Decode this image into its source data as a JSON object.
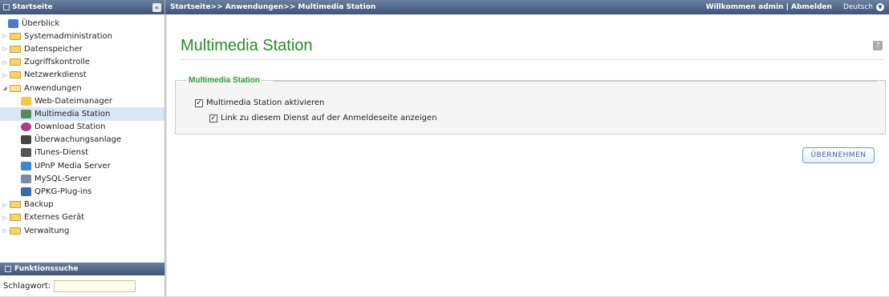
{
  "sidebar": {
    "title": "Startseite",
    "collapse_glyph": "«",
    "items": [
      {
        "label": "Überblick",
        "level": "top",
        "icon": "overview-icon"
      },
      {
        "label": "Systemadministration",
        "level": "folder"
      },
      {
        "label": "Datenspeicher",
        "level": "folder"
      },
      {
        "label": "Zugriffskontrolle",
        "level": "folder"
      },
      {
        "label": "Netzwerkdienst",
        "level": "folder"
      },
      {
        "label": "Anwendungen",
        "level": "folder-open"
      },
      {
        "label": "Web-Dateimanager",
        "level": "child",
        "icon": "folder-icon",
        "color": "#f3c84a"
      },
      {
        "label": "Multimedia Station",
        "level": "child",
        "icon": "multimedia-icon",
        "color": "#5a8a5a",
        "selected": true
      },
      {
        "label": "Download Station",
        "level": "child",
        "icon": "download-icon",
        "color": "#b03a8a"
      },
      {
        "label": "Überwachungsanlage",
        "level": "child",
        "icon": "camera-icon",
        "color": "#444444"
      },
      {
        "label": "iTunes-Dienst",
        "level": "child",
        "icon": "apple-icon",
        "color": "#555555"
      },
      {
        "label": "UPnP Media Server",
        "level": "child",
        "icon": "upnp-icon",
        "color": "#3a8ac7"
      },
      {
        "label": "MySQL-Server",
        "level": "child",
        "icon": "mysql-icon",
        "color": "#7a8aa0"
      },
      {
        "label": "QPKG-Plug-ins",
        "level": "child",
        "icon": "qpkg-icon",
        "color": "#3a6ab0"
      },
      {
        "label": "Backup",
        "level": "folder"
      },
      {
        "label": "Externes Gerät",
        "level": "folder"
      },
      {
        "label": "Verwaltung",
        "level": "folder"
      }
    ]
  },
  "search": {
    "title": "Funktionssuche",
    "label": "Schlagwort:",
    "value": ""
  },
  "topbar": {
    "breadcrumb": "Startseite>> Anwendungen>> Multimedia Station",
    "welcome": "Willkommen admin | Abmelden",
    "language": "Deutsch"
  },
  "main": {
    "title": "Multimedia Station",
    "help_glyph": "?",
    "panel_legend": "Multimedia Station",
    "options": [
      {
        "label": "Multimedia Station aktivieren",
        "checked": true
      },
      {
        "label": "Link zu diesem Dienst auf der Anmeldeseite anzeigen",
        "checked": true
      }
    ],
    "apply_label": "ÜBERNEHMEN"
  }
}
